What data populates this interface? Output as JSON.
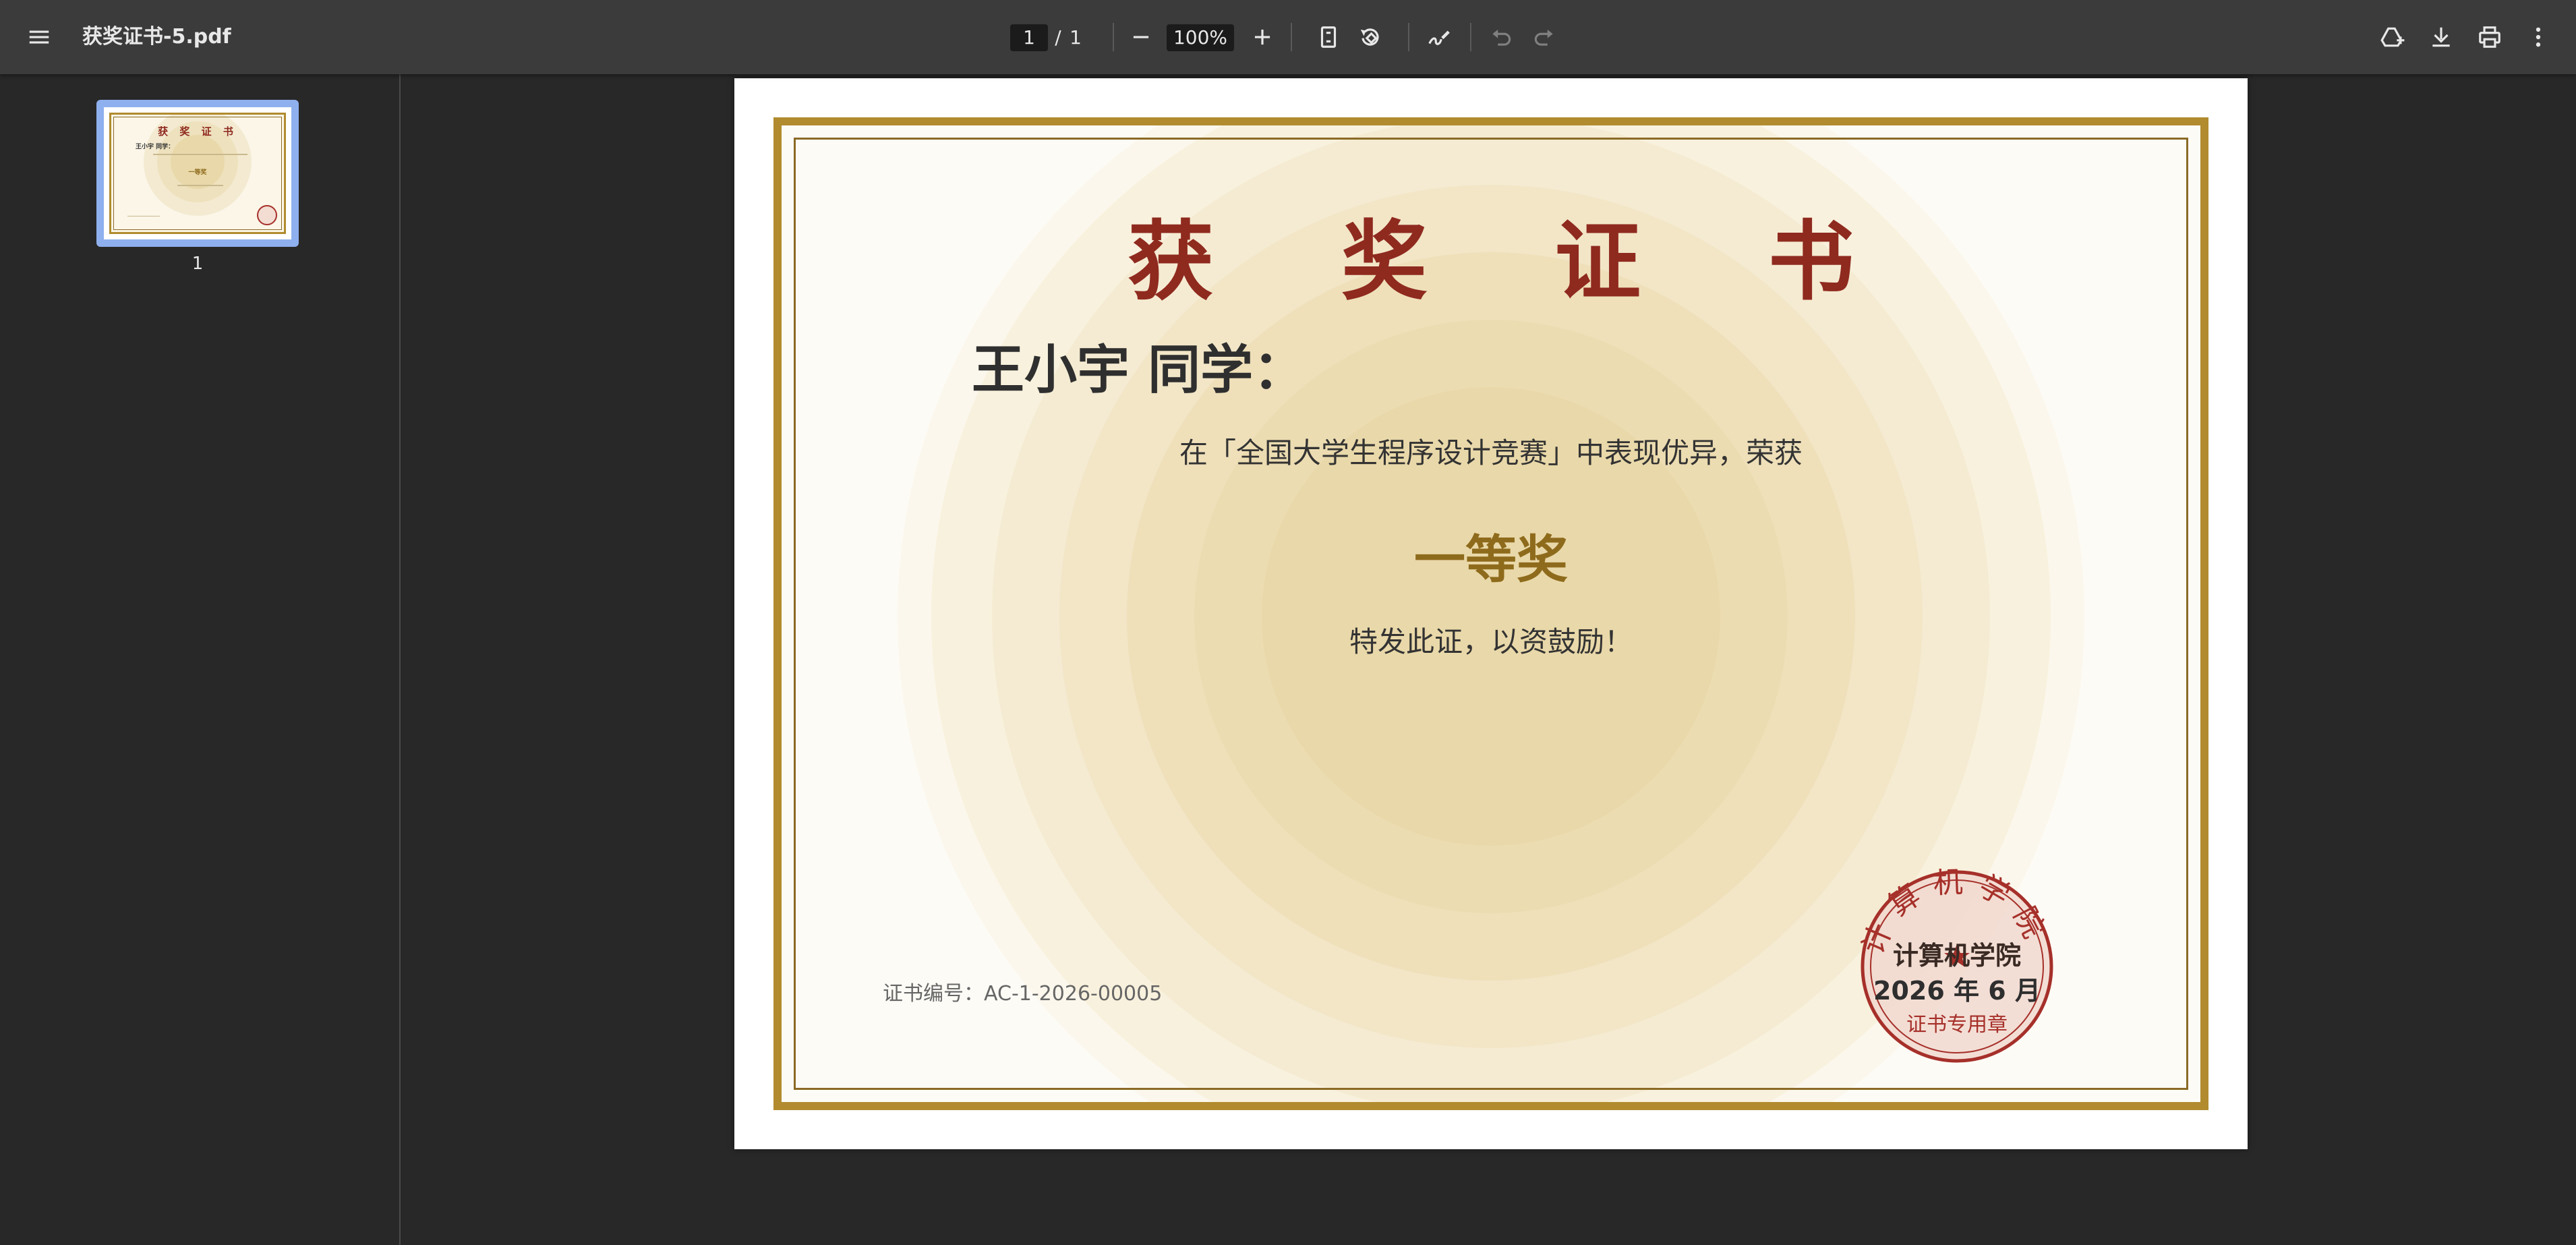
{
  "app": {
    "document_title": "获奖证书-5.pdf",
    "menu_icon": "menu-icon"
  },
  "toolbar": {
    "current_page": "1",
    "page_separator": "/",
    "total_pages": "1",
    "zoom_level": "100%",
    "icons": {
      "zoom_out": "minus-icon",
      "zoom_in": "plus-icon",
      "fit_page": "fit-page-icon",
      "rotate": "rotate-icon",
      "annotate": "pen-icon",
      "undo": "undo-icon",
      "redo": "redo-icon",
      "save_to_drive": "drive-add-icon",
      "download": "download-icon",
      "print": "print-icon",
      "more": "more-vertical-icon"
    }
  },
  "sidebar": {
    "thumbnails": [
      {
        "label": "1",
        "selected": true
      }
    ]
  },
  "certificate": {
    "title": "获 奖 证 书",
    "recipient": "王小宇 同学：",
    "line1": "在「全国大学生程序设计竞赛」中表现优异，荣获",
    "award": "一等奖",
    "line2": "特发此证，以资鼓励！",
    "number": "证书编号：AC-1-2026-00005",
    "seal": {
      "ring_text": "计算机学院",
      "org": "计算机学院",
      "date": "2026 年 6 月",
      "label": "证书专用章"
    },
    "colors": {
      "border": "#b18b2e",
      "title": "#8f2a1f",
      "award": "#8e6b1c",
      "seal": "#a6302a"
    }
  },
  "thumbnail_text": {
    "title": "获 奖 证 书",
    "recipient": "王小宇 同学：",
    "award": "一等奖"
  }
}
